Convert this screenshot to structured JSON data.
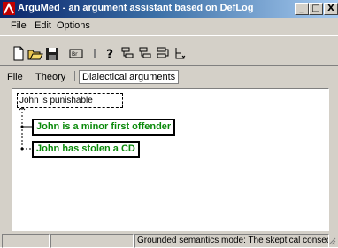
{
  "window": {
    "title": "ArguMed - an argument assistant based on DefLog",
    "minimize": "_",
    "maximize": "□",
    "close": "X"
  },
  "menu": [
    "File",
    "Edit",
    "Options"
  ],
  "toolbar": [
    "new-icon",
    "open-icon",
    "save-icon",
    "icon-1",
    "icon-2",
    "help-icon",
    "tree-icon-1",
    "tree-icon-2",
    "tree-icon-3",
    "tree-icon-4"
  ],
  "toolbar_labels": {
    "help": "?"
  },
  "tabs": {
    "file": "File",
    "theory": "Theory",
    "dialectical": "Dialectical arguments"
  },
  "diagram": {
    "issue": "John is punishable",
    "reason_1": "John is a minor first offender",
    "reason_2": "John has stolen a CD",
    "reason_color": "#0a8a0a"
  },
  "status": {
    "cell_1": "",
    "cell_2": "",
    "mode_text": "Grounded semantics mode: The skeptical consequences"
  }
}
